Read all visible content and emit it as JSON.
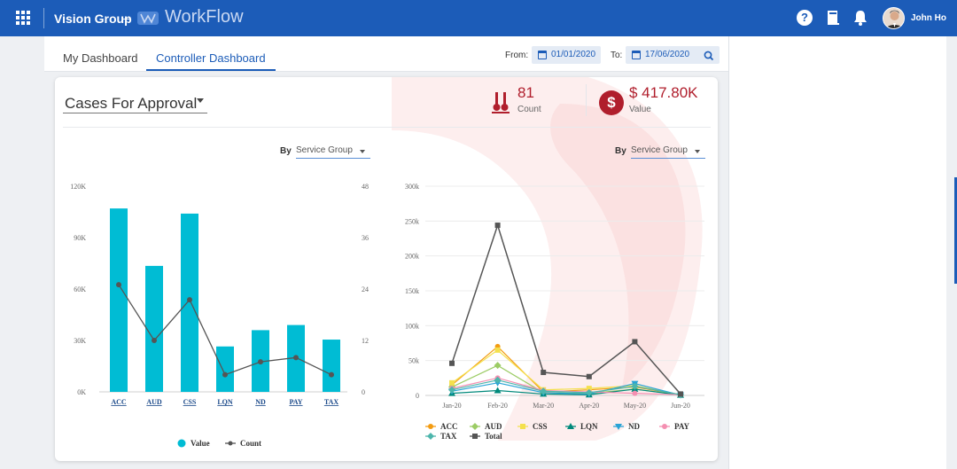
{
  "header": {
    "org_name": "Vision Group",
    "separator": "–",
    "app_name": "WorkFlow",
    "user_name": "John Ho",
    "help_glyph": "?",
    "icons": [
      "grid-icon",
      "help-icon",
      "book-icon",
      "bell-icon",
      "avatar"
    ]
  },
  "tabs": [
    {
      "label": "My Dashboard",
      "active": false
    },
    {
      "label": "Controller Dashboard",
      "active": true
    }
  ],
  "filters": {
    "from_label": "From:",
    "from_value": "01/01/2020",
    "to_label": "To:",
    "to_value": "17/06/2020"
  },
  "card": {
    "title": "Cases For Approval",
    "count_value": "81",
    "count_label": "Count",
    "value_value": "$ 417.80K",
    "value_label": "Value",
    "currency_glyph": "$"
  },
  "left_selector": {
    "by_label": "By",
    "value": "Service Group"
  },
  "right_selector": {
    "by_label": "By",
    "value": "Service Group"
  },
  "colors": {
    "brand": "#1c5cb8",
    "kpi": "#b01e2c",
    "bar": "#00bcd4",
    "count_line": "#555555"
  },
  "chart_data": [
    {
      "type": "bar",
      "categories": [
        "ACC",
        "AUD",
        "CSS",
        "LQN",
        "ND",
        "PAY",
        "TAX"
      ],
      "series": [
        {
          "name": "Value",
          "type": "bar",
          "axis": "left",
          "values": [
            107000,
            73500,
            104000,
            26500,
            36000,
            39000,
            30500
          ]
        },
        {
          "name": "Count",
          "type": "line",
          "axis": "right",
          "values": [
            25,
            12,
            21.5,
            4,
            7,
            8,
            4
          ]
        }
      ],
      "y_left": {
        "ticks": [
          "0K",
          "30K",
          "60K",
          "90K",
          "120K"
        ],
        "ylim": [
          0,
          120000
        ]
      },
      "y_right": {
        "ticks": [
          "0",
          "12",
          "24",
          "36",
          "48"
        ],
        "ylim": [
          0,
          48
        ]
      },
      "legend": "bottom",
      "grid": false
    },
    {
      "type": "line",
      "categories": [
        "Jan-20",
        "Feb-20",
        "Mar-20",
        "Apr-20",
        "May-20",
        "Jun-20"
      ],
      "series": [
        {
          "name": "ACC",
          "color": "#f39c12",
          "values": [
            15000,
            70000,
            5000,
            8000,
            12000,
            1000
          ]
        },
        {
          "name": "AUD",
          "color": "#9ccc65",
          "values": [
            12000,
            43000,
            4000,
            3000,
            9000,
            1000
          ]
        },
        {
          "name": "CSS",
          "color": "#f4e04d",
          "values": [
            18000,
            65000,
            8000,
            10000,
            14000,
            1000
          ]
        },
        {
          "name": "LQN",
          "color": "#00897b",
          "values": [
            3000,
            7000,
            2000,
            1000,
            9000,
            500
          ]
        },
        {
          "name": "ND",
          "color": "#29a3d6",
          "values": [
            6000,
            18000,
            4000,
            2000,
            17000,
            500
          ]
        },
        {
          "name": "PAY",
          "color": "#f48fb1",
          "values": [
            10000,
            25000,
            7000,
            5000,
            3000,
            1000
          ]
        },
        {
          "name": "TAX",
          "color": "#4db6ac",
          "values": [
            8000,
            22000,
            6000,
            4000,
            13000,
            1000
          ]
        },
        {
          "name": "Total",
          "color": "#555555",
          "values": [
            46000,
            244000,
            33000,
            27000,
            77000,
            2000
          ]
        }
      ],
      "y_ticks": [
        "0",
        "50k",
        "100k",
        "150k",
        "200k",
        "250k",
        "300k"
      ],
      "ylim": [
        0,
        300000
      ],
      "legend": "bottom",
      "grid": true
    }
  ]
}
